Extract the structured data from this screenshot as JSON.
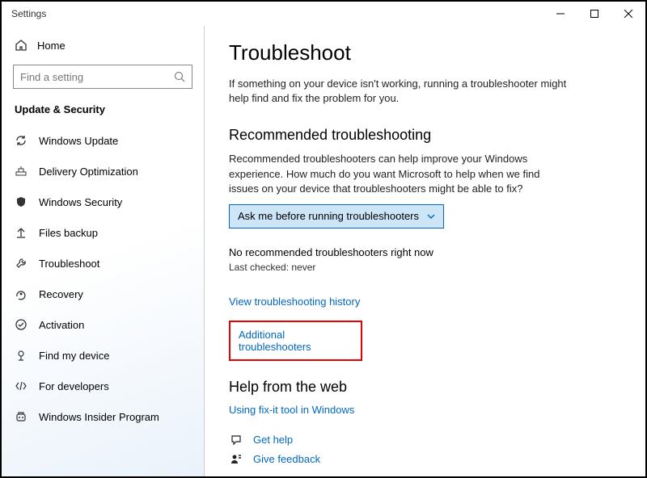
{
  "window": {
    "title": "Settings"
  },
  "sidebar": {
    "home": "Home",
    "search_placeholder": "Find a setting",
    "section": "Update & Security",
    "items": [
      {
        "label": "Windows Update"
      },
      {
        "label": "Delivery Optimization"
      },
      {
        "label": "Windows Security"
      },
      {
        "label": "Files backup"
      },
      {
        "label": "Troubleshoot"
      },
      {
        "label": "Recovery"
      },
      {
        "label": "Activation"
      },
      {
        "label": "Find my device"
      },
      {
        "label": "For developers"
      },
      {
        "label": "Windows Insider Program"
      }
    ]
  },
  "main": {
    "title": "Troubleshoot",
    "intro": "If something on your device isn't working, running a troubleshooter might help find and fix the problem for you.",
    "rec_heading": "Recommended troubleshooting",
    "rec_text": "Recommended troubleshooters can help improve your Windows experience. How much do you want Microsoft to help when we find issues on your device that troubleshooters might be able to fix?",
    "dropdown_value": "Ask me before running troubleshooters",
    "no_rec": "No recommended troubleshooters right now",
    "last_checked": "Last checked: never",
    "history_link": "View troubleshooting history",
    "additional_link": "Additional troubleshooters",
    "help_heading": "Help from the web",
    "fixit_link": "Using fix-it tool in Windows",
    "get_help": "Get help",
    "give_feedback": "Give feedback"
  }
}
